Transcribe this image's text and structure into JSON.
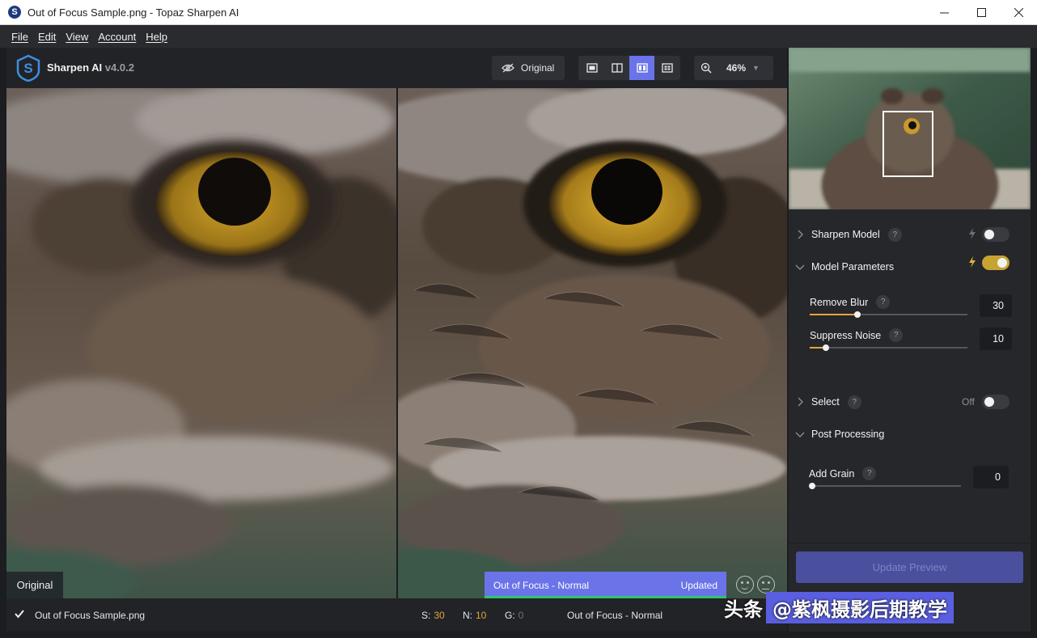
{
  "window": {
    "title": "Out of Focus Sample.png - Topaz Sharpen AI",
    "minimize_icon": "minimize-icon",
    "maximize_icon": "maximize-icon",
    "close_icon": "close-icon"
  },
  "menu": [
    "File",
    "Edit",
    "View",
    "Account",
    "Help"
  ],
  "toolbar": {
    "app_name": "Sharpen AI",
    "version": "v4.0.2",
    "original_label": "Original",
    "zoom": "46%"
  },
  "preview": {
    "left_label": "Original",
    "model_label": "Out of Focus - Normal",
    "model_status": "Updated"
  },
  "status": {
    "file_name": "Out of Focus Sample.png",
    "s_label": "S:",
    "s_value": "30",
    "n_label": "N:",
    "n_value": "10",
    "g_label": "G:",
    "g_value": "0",
    "model_name": "Out of Focus - Normal"
  },
  "panel": {
    "sharpen_model": {
      "title": "Sharpen Model",
      "help": "?",
      "enabled": false
    },
    "model_parameters": {
      "title": "Model Parameters",
      "enabled": true,
      "remove_blur": {
        "label": "Remove Blur",
        "help": "?",
        "value": "30",
        "fraction": 0.3
      },
      "suppress_noise": {
        "label": "Suppress Noise",
        "help": "?",
        "value": "10",
        "fraction": 0.1
      }
    },
    "select": {
      "title": "Select",
      "help": "?",
      "state_text": "Off",
      "enabled": false
    },
    "post_processing": {
      "title": "Post Processing",
      "add_grain": {
        "label": "Add Grain",
        "help": "?",
        "value": "0",
        "fraction": 0
      }
    },
    "update_preview": "Update Preview"
  },
  "watermark": {
    "prefix": "头条",
    "handle": "@紫枫摄影后期教学"
  },
  "colors": {
    "accent": "#6a73e8",
    "slider": "#e2a83b",
    "toggle_on": "#c6a432",
    "status_value": "#e0a63c"
  }
}
